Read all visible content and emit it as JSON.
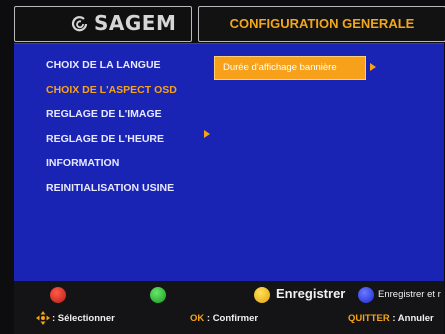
{
  "header": {
    "logo_text": "SAGEM",
    "title": "CONFIGURATION GENERALE"
  },
  "menu": {
    "items": [
      {
        "label": "CHOIX DE LA LANGUE"
      },
      {
        "label": "CHOIX DE L'ASPECT OSD"
      },
      {
        "label": "REGLAGE DE L'IMAGE"
      },
      {
        "label": "REGLAGE DE L'HEURE"
      },
      {
        "label": "INFORMATION"
      },
      {
        "label": "REINITIALISATION USINE"
      }
    ],
    "selected_index": 1
  },
  "submenu": {
    "items": [
      {
        "label": "Durée d'affichage bannière"
      }
    ]
  },
  "footer": {
    "buttons": [
      {
        "color": "red",
        "label": ""
      },
      {
        "color": "green",
        "label": ""
      },
      {
        "color": "yellow",
        "label": "Enregistrer"
      },
      {
        "color": "blue",
        "label": "Enregistrer et r"
      }
    ],
    "hints": {
      "select": {
        "key": "",
        "text": ": Sélectionner"
      },
      "ok": {
        "key": "OK",
        "text": ": Confirmer"
      },
      "quit": {
        "key": "QUITTER",
        "text": ": Annuler"
      }
    }
  },
  "colors": {
    "panel_bg": "#1a24b4",
    "accent": "#f6a318",
    "menu_text": "#e8e8ff",
    "red": "#d02a1c",
    "green": "#1fb52a",
    "yellow": "#f2b91d",
    "blue": "#2a3ae0"
  }
}
